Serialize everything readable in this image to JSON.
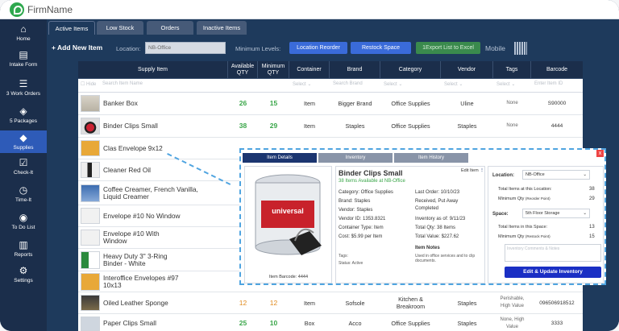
{
  "app": {
    "brand": "FirmName"
  },
  "sidebar": {
    "items": [
      {
        "label": "Home",
        "icon": "home-icon"
      },
      {
        "label": "Intake Form",
        "icon": "document-icon"
      },
      {
        "label": "3 Work Orders",
        "icon": "list-icon"
      },
      {
        "label": "5 Packages",
        "icon": "box-icon"
      },
      {
        "label": "Supplies",
        "icon": "tag-icon"
      },
      {
        "label": "Check-It",
        "icon": "checkbox-icon"
      },
      {
        "label": "Time-It",
        "icon": "clock-icon"
      },
      {
        "label": "To Do List",
        "icon": "target-icon"
      },
      {
        "label": "Reports",
        "icon": "report-icon"
      },
      {
        "label": "Settings",
        "icon": "gear-icon"
      }
    ]
  },
  "tabs": [
    "Active Items",
    "Low Stock",
    "Orders",
    "Inactive Items"
  ],
  "toolbar": {
    "add_new": "Add New Item",
    "location_label": "Location:",
    "location_value": "NB-Office",
    "min_levels": "Minimum Levels:",
    "btn_location_reorder": "Location Reorder",
    "btn_restock_space": "Restock Space",
    "btn_export": "1Export List to Excel",
    "mobile": "Mobile"
  },
  "table": {
    "headers": [
      "Supply Item",
      "Available QTY",
      "Minimum QTY",
      "Container",
      "Brand",
      "Category",
      "Vendor",
      "Tags",
      "Barcode"
    ],
    "filters": {
      "hide": "Hide",
      "search_name": "Search Item Name",
      "select": "Select",
      "search_brand": "Search Brand",
      "enter_id": "Enter Item ID"
    },
    "rows": [
      {
        "name": "Banker Box",
        "avail": "26",
        "min": "15",
        "container": "Item",
        "brand": "Bigger Brand",
        "category": "Office Supplies",
        "vendor": "Uline",
        "tags": "None",
        "barcode": "S90000"
      },
      {
        "name": "Binder Clips Small",
        "avail": "38",
        "min": "29",
        "container": "Item",
        "brand": "Staples",
        "category": "Office Supplies",
        "vendor": "Staples",
        "tags": "None",
        "barcode": "4444"
      },
      {
        "name": "Clas Envelope 9x12"
      },
      {
        "name": "Cleaner Red Oil"
      },
      {
        "name": "Coffee Creamer, French Vanilla, Liquid Creamer"
      },
      {
        "name": "Envelope #10 No Window"
      },
      {
        "name": "Envelope #10 With Window"
      },
      {
        "name": "Heavy Duty 3\" 3-Ring Binder - White"
      },
      {
        "name": "Interoffice Envelopes #97 10x13"
      },
      {
        "name": "Oiled Leather Sponge",
        "avail": "12",
        "min": "12",
        "container": "Item",
        "brand": "Sofsole",
        "category": "Kitchen & Breakroom",
        "vendor": "Staples",
        "tags": "Perishable, High Value",
        "barcode": "096506918512"
      },
      {
        "name": "Paper Clips Small",
        "avail": "25",
        "min": "10",
        "container": "Box",
        "brand": "Acco",
        "category": "Office Supplies",
        "vendor": "Staples",
        "tags": "None, High Value",
        "barcode": "3333"
      }
    ]
  },
  "popup": {
    "tabs": [
      "Item Details",
      "Inventory",
      "Item History"
    ],
    "close": "x",
    "title": "Binder Clips Small",
    "edit": "Edit Item",
    "avail": "38 Items Available at NB-Office",
    "category": "Category: Office Supplies",
    "brand": "Brand: Staples",
    "vendor": "Vendor: Staples",
    "vendor_id": "Vendor ID: 1353.8321",
    "container": "Container Type: Item",
    "cost": "Cost: $5.99 per Item",
    "last_order": "Last Order: 10/10/23",
    "received": "Received, Put Away",
    "completed": "Completed",
    "inv_asof": "Inventory as of: 9/11/23",
    "total_qty": "Total Qty: 38 Items",
    "total_value": "Total Value: $227.62",
    "notes_title": "Item Notes",
    "notes": "Used in office services and to clip documents.",
    "tags": "Tags:",
    "status": "Status: Active",
    "barcode": "Item Barcode: 4444",
    "product_text": "universal",
    "loc_label": "Location:",
    "loc_value": "NB-Office",
    "total_loc": "Total Items at this Location:",
    "total_loc_v": "38",
    "min_qty": "Minimum Qty",
    "min_qty_sub": "(Reorder Point)",
    "min_qty_v": "29",
    "space_label": "Space:",
    "space_value": "5th Floor Storage",
    "total_space": "Total Items in this Space:",
    "total_space_v": "13",
    "min_qty2_sub": "(Restock Point)",
    "min_qty2_v": "15",
    "comments_placeholder": "Inventory Comments & Notes",
    "update_btn": "Edit & Update Inventory"
  }
}
